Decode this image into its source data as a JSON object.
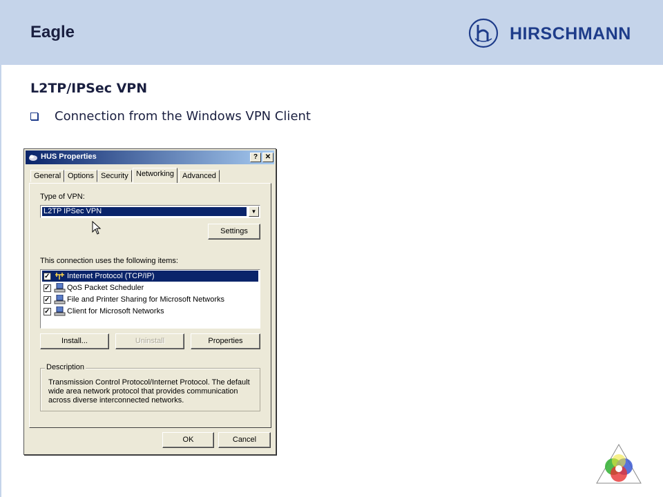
{
  "slide": {
    "title": "Eagle",
    "brand": "HIRSCHMANN",
    "heading": "L2TP/IPSec VPN",
    "bullet": "Connection from the Windows VPN Client"
  },
  "dialog": {
    "title": "HUS Properties",
    "help_button": "?",
    "close_button": "✕",
    "tabs": [
      {
        "label": "General"
      },
      {
        "label": "Options"
      },
      {
        "label": "Security"
      },
      {
        "label": "Networking"
      },
      {
        "label": "Advanced"
      }
    ],
    "active_tab": "Networking",
    "vpn_type_label": "Type of VPN:",
    "vpn_type_value": "L2TP IPSec VPN",
    "settings_button": "Settings",
    "items_label": "This connection uses the following items:",
    "items": [
      {
        "label": "Internet Protocol (TCP/IP)",
        "checked": true,
        "selected": true,
        "icon": "protocol-icon"
      },
      {
        "label": "QoS Packet Scheduler",
        "checked": true,
        "selected": false,
        "icon": "network-service-icon"
      },
      {
        "label": "File and Printer Sharing for Microsoft Networks",
        "checked": true,
        "selected": false,
        "icon": "network-service-icon"
      },
      {
        "label": "Client for Microsoft Networks",
        "checked": true,
        "selected": false,
        "icon": "network-client-icon"
      }
    ],
    "install_button": "Install...",
    "uninstall_button": "Uninstall",
    "properties_button": "Properties",
    "description_title": "Description",
    "description_text": "Transmission Control Protocol/Internet Protocol. The default wide area network protocol that provides communication across diverse interconnected networks.",
    "ok_button": "OK",
    "cancel_button": "Cancel"
  },
  "colors": {
    "header_band": "#c5d4ea",
    "brand_blue": "#1e3c8a",
    "selection": "#0a246a",
    "dialog_face": "#ece9d8"
  }
}
